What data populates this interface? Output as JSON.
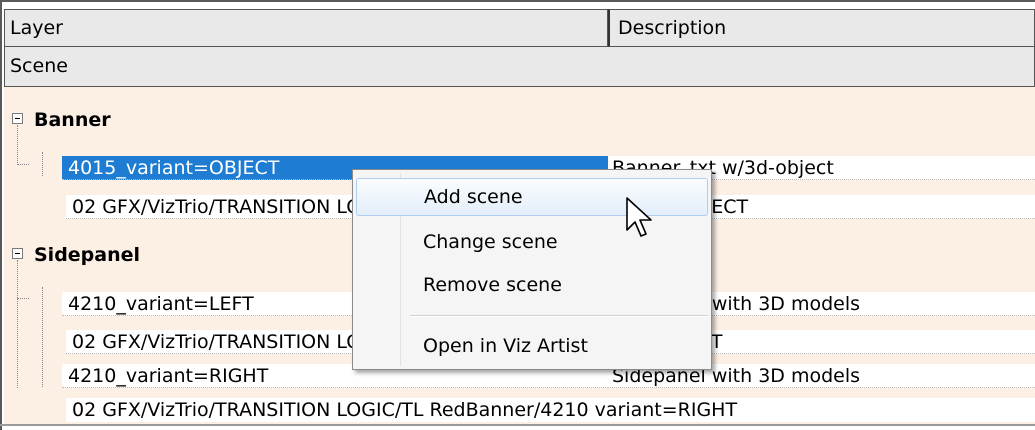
{
  "columns": {
    "layer": "Layer",
    "description": "Description"
  },
  "scene_header": "Scene",
  "groups": [
    {
      "name": "Banner",
      "rows": [
        {
          "layer": "4015_variant=OBJECT",
          "description": "Banner_txt w/3d-object",
          "selected": true
        },
        {
          "layer": "02  GFX/VizTrio/TRANSITION  LOGIC/TL  RedBanner/4015  variant=OBJECT",
          "description": ""
        }
      ]
    },
    {
      "name": "Sidepanel",
      "rows": [
        {
          "layer": "4210_variant=LEFT",
          "description": "Sidepanel with 3D models"
        },
        {
          "layer": "02  GFX/VizTrio/TRANSITION  LOGIC/TL  RedBanner/4210  variant=LEFT",
          "description": ""
        },
        {
          "layer": "4210_variant=RIGHT",
          "description": "Sidepanel with 3D models"
        },
        {
          "layer": "02  GFX/VizTrio/TRANSITION  LOGIC/TL  RedBanner/4210  variant=RIGHT",
          "description": ""
        }
      ]
    }
  ],
  "context_menu": {
    "items": [
      "Add scene",
      "Change scene",
      "Remove scene",
      "Open in Viz Artist"
    ],
    "highlighted": "Add scene"
  },
  "colors": {
    "selection": "#1e7dd2",
    "tree_background": "#fcefe4",
    "header_background": "#e9e9e9"
  }
}
